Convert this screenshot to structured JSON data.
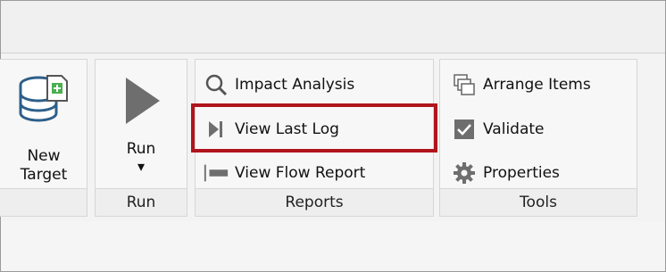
{
  "ribbon": {
    "groups": {
      "target": {
        "new_target_line1": "New",
        "new_target_line2": "Target",
        "icon": "database-add-icon"
      },
      "run": {
        "run_label": "Run",
        "dropdown_glyph": "▾",
        "group_label": "Run",
        "icon": "play-icon"
      },
      "reports": {
        "items": [
          {
            "label": "Impact Analysis",
            "icon": "magnifier-icon"
          },
          {
            "label": "View Last Log",
            "icon": "skip-end-icon"
          },
          {
            "label": "View Flow Report",
            "icon": "flow-report-icon"
          }
        ],
        "group_label": "Reports"
      },
      "tools": {
        "items": [
          {
            "label": "Arrange Items",
            "icon": "arrange-windows-icon"
          },
          {
            "label": "Validate",
            "icon": "checkbox-icon"
          },
          {
            "label": "Properties",
            "icon": "gear-icon"
          }
        ],
        "group_label": "Tools"
      }
    },
    "highlight_color": "#b0141c"
  }
}
